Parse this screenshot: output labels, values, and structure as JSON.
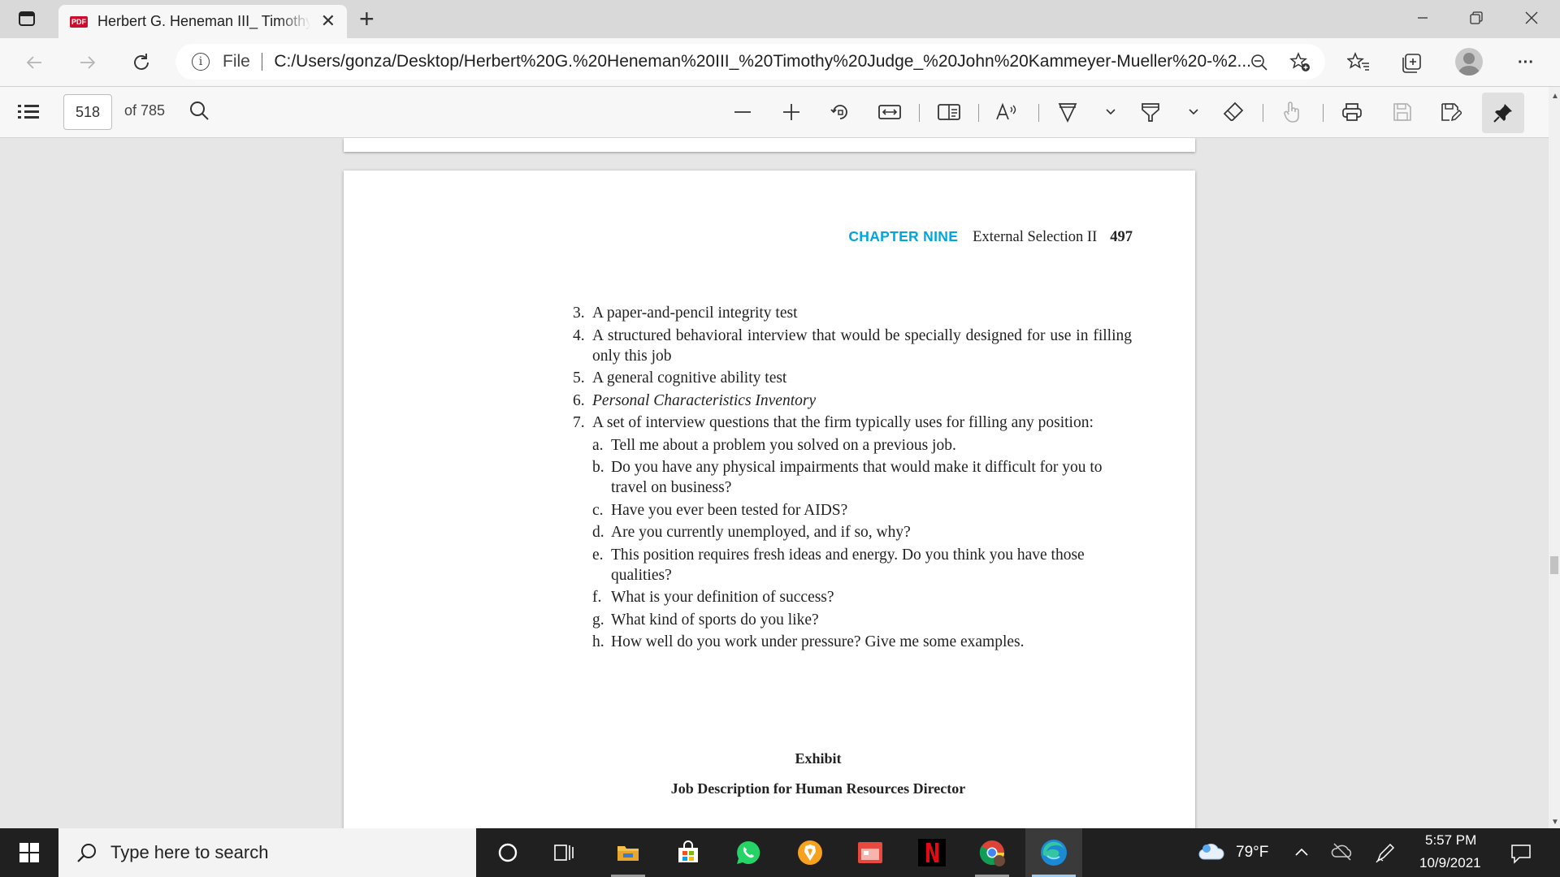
{
  "browser": {
    "tab_title": "Herbert G. Heneman III_ Timothy",
    "tab_favicon_text": "PDF",
    "new_tab": "+",
    "address": {
      "scheme_label": "File",
      "url": "C:/Users/gonza/Desktop/Herbert%20G.%20Heneman%20III_%20Timothy%20Judge_%20John%20Kammeyer-Mueller%20-%2..."
    },
    "more_label": "···"
  },
  "pdf_toolbar": {
    "current_page": "518",
    "total_pages": "of 785"
  },
  "document": {
    "running_head": {
      "chapter": "CHAPTER NINE",
      "section": "External Selection II",
      "page_number": "497"
    },
    "items": [
      {
        "num": "3.",
        "text": "A paper-and-pencil integrity test",
        "italic": false
      },
      {
        "num": "4.",
        "text": "A structured behavioral interview that would be specially designed for use in filling only this job",
        "italic": false
      },
      {
        "num": "5.",
        "text": "A general cognitive ability test",
        "italic": false
      },
      {
        "num": "6.",
        "text": "Personal Characteristics Inventory",
        "italic": true
      },
      {
        "num": "7.",
        "text": "A set of interview questions that the firm typically uses for filling any position:",
        "italic": false
      }
    ],
    "subitems": [
      {
        "letter": "a.",
        "text": "Tell me about a problem you solved on a previous job."
      },
      {
        "letter": "b.",
        "text": "Do you have any physical impairments that would make it difficult for you to travel on business?"
      },
      {
        "letter": "c.",
        "text": "Have you ever been tested for AIDS?"
      },
      {
        "letter": "d.",
        "text": "Are you currently unemployed, and if so, why?"
      },
      {
        "letter": "e.",
        "text": "This position requires fresh ideas and energy. Do you think you have those qualities?"
      },
      {
        "letter": "f.",
        "text": "What is your definition of success?"
      },
      {
        "letter": "g.",
        "text": "What kind of sports do you like?"
      },
      {
        "letter": "h.",
        "text": "How well do you work under pressure? Give me some examples."
      }
    ],
    "exhibit_title": "Exhibit",
    "exhibit_subtitle": "Job Description for Human Resources Director"
  },
  "taskbar": {
    "search_placeholder": "Type here to search",
    "weather": "79°F",
    "time": "5:57 PM",
    "date": "10/9/2021"
  },
  "colors": {
    "chapter_accent": "#00a6de",
    "taskbar": "#202020",
    "page_bg": "#ffffff",
    "viewer_bg": "#e6e6e6"
  }
}
